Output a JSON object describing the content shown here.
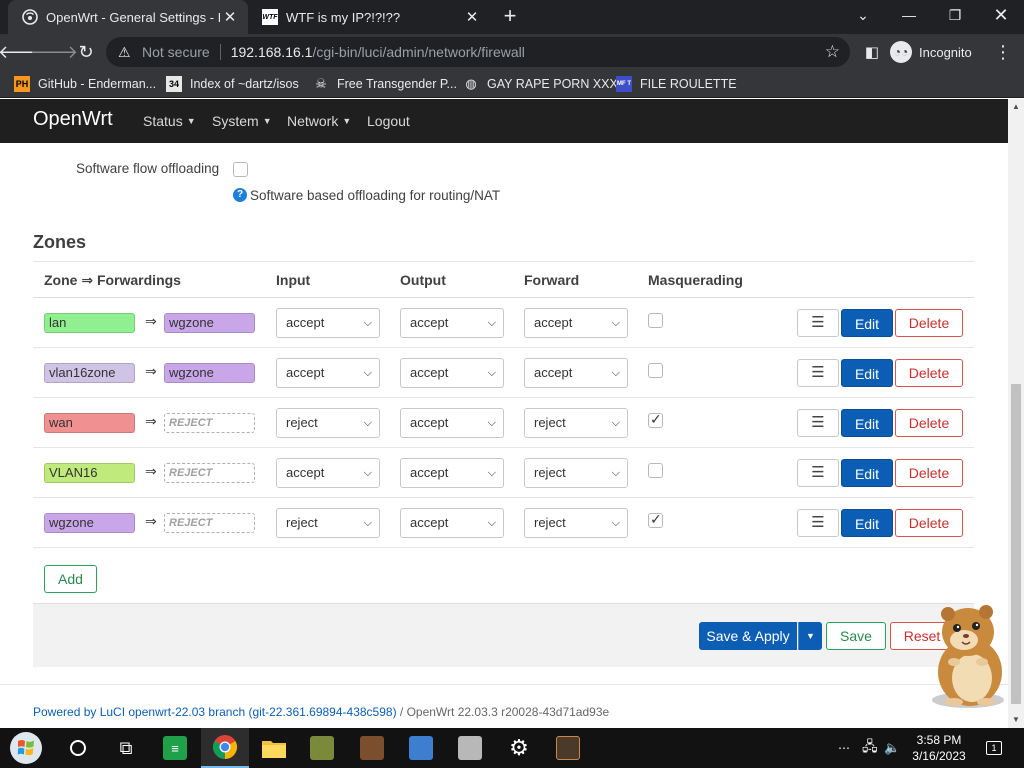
{
  "browser": {
    "tabs": [
      {
        "title": "OpenWrt - General Settings - LuCI",
        "active": true,
        "icon": "openwrt-favicon"
      },
      {
        "title": "WTF is my IP?!?!??",
        "active": false,
        "icon": "wtf-favicon",
        "icon_text": "WTF"
      }
    ],
    "address": {
      "security_label": "Not secure",
      "host": "192.168.16.1",
      "path": "/cgi-bin/luci/admin/network/firewall"
    },
    "profile_label": "Incognito",
    "bookmarks": [
      {
        "label": "GitHub - Enderman...",
        "icon": "ph-icon",
        "icon_text": "PH",
        "color": "#f7971d"
      },
      {
        "label": "Index of ~dartz/isos",
        "icon": "folder-34-icon",
        "icon_text": "34"
      },
      {
        "label": "Free Transgender P...",
        "icon": "skull-icon"
      },
      {
        "label": "GAY RAPE PORN XXX",
        "icon": "globe-icon"
      },
      {
        "label": "FILE ROULETTE",
        "icon": "roulette-icon",
        "icon_text": "MF T"
      }
    ]
  },
  "luci": {
    "brand": "OpenWrt",
    "menu": [
      "Status",
      "System",
      "Network",
      "Logout"
    ],
    "offload": {
      "label": "Software flow offloading",
      "help": "Software based offloading for routing/NAT",
      "checked": false
    },
    "zones_title": "Zones",
    "columns": {
      "zone": "Zone ⇒ Forwardings",
      "input": "Input",
      "output": "Output",
      "forward": "Forward",
      "masq": "Masquerading"
    },
    "zones": [
      {
        "name": "lan",
        "color": "#90f090",
        "arrow": "⇒",
        "forward_to": "wgzone",
        "forward_color": "#c8a6e8",
        "input": "accept",
        "output": "accept",
        "forward": "accept",
        "masq": false
      },
      {
        "name": "vlan16zone",
        "color": "#d0c4e6",
        "arrow": "⇒",
        "forward_to": "wgzone",
        "forward_color": "#c8a6e8",
        "input": "accept",
        "output": "accept",
        "forward": "accept",
        "masq": false
      },
      {
        "name": "wan",
        "color": "#f09090",
        "arrow": "⇒",
        "forward_to": "REJECT",
        "forward_color": "",
        "input": "reject",
        "output": "accept",
        "forward": "reject",
        "masq": true
      },
      {
        "name": "VLAN16",
        "color": "#c0ea7c",
        "arrow": "⇒",
        "forward_to": "REJECT",
        "forward_color": "",
        "input": "accept",
        "output": "accept",
        "forward": "reject",
        "masq": false
      },
      {
        "name": "wgzone",
        "color": "#c8a6e8",
        "arrow": "⇒",
        "forward_to": "REJECT",
        "forward_color": "",
        "input": "reject",
        "output": "accept",
        "forward": "reject",
        "masq": true
      }
    ],
    "row_buttons": {
      "drag": "☰",
      "edit": "Edit",
      "delete": "Delete"
    },
    "add_label": "Add",
    "actions": {
      "save_apply": "Save & Apply",
      "save": "Save",
      "reset": "Reset"
    },
    "footer": {
      "link": "Powered by LuCI openwrt-22.03 branch (git-22.361.69894-438c598)",
      "version": " / OpenWrt 22.03.3 r20028-43d71ad93e"
    }
  },
  "taskbar": {
    "time": "3:58 PM",
    "date": "3/16/2023",
    "notifications": "1"
  }
}
